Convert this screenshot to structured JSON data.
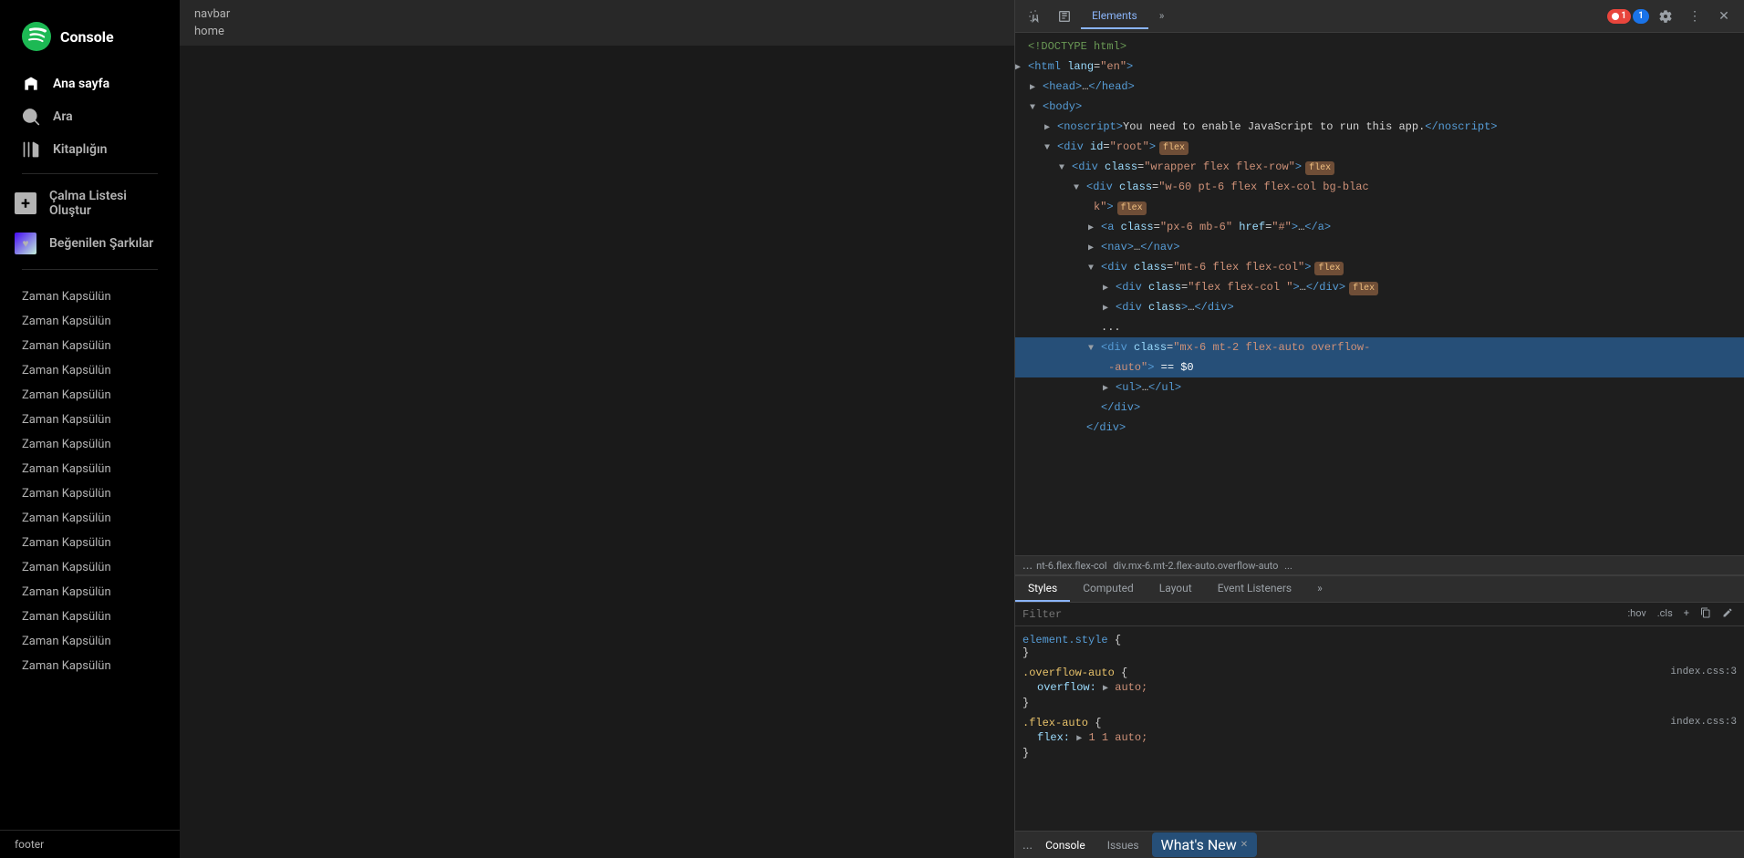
{
  "sidebar": {
    "logo_text": "Spotify",
    "nav_items": [
      {
        "id": "home",
        "label": "Ana sayfa",
        "icon": "home-icon",
        "active": true
      },
      {
        "id": "search",
        "label": "Ara",
        "icon": "search-icon",
        "active": false
      },
      {
        "id": "library",
        "label": "Kitaplığın",
        "icon": "library-icon",
        "active": false
      }
    ],
    "actions": [
      {
        "id": "create-playlist",
        "label": "Çalma Listesi Oluştur",
        "icon": "plus-icon"
      },
      {
        "id": "liked-songs",
        "label": "Beğenilen Şarkılar",
        "icon": "heart-icon"
      }
    ],
    "playlists": [
      "Zaman Kapsülün",
      "Zaman Kapsülün",
      "Zaman Kapsülün",
      "Zaman Kapsülün",
      "Zaman Kapsülün",
      "Zaman Kapsülün",
      "Zaman Kapsülün",
      "Zaman Kapsülün",
      "Zaman Kapsülün",
      "Zaman Kapsülün",
      "Zaman Kapsülün",
      "Zaman Kapsülün",
      "Zaman Kapsülün",
      "Zaman Kapsülün",
      "Zaman Kapsülün",
      "Zaman Kapsülün"
    ],
    "footer_label": "footer"
  },
  "main_content": {
    "header_labels": [
      "navbar",
      "home"
    ]
  },
  "devtools": {
    "toolbar": {
      "inspect_icon": "inspect-icon",
      "device_icon": "device-icon",
      "tabs": [
        "Elements",
        "»"
      ],
      "active_tab": "Elements",
      "error_badge": "1",
      "warning_badge": "1",
      "settings_icon": "settings-icon",
      "more_icon": "more-icon",
      "close_icon": "close-icon"
    },
    "dom": {
      "lines": [
        {
          "indent": 0,
          "triangle": "none",
          "content": "<!DOCTYPE html>",
          "type": "doctype"
        },
        {
          "indent": 0,
          "triangle": "closed",
          "content": "<html lang=\"en\">",
          "type": "tag"
        },
        {
          "indent": 1,
          "triangle": "closed",
          "content": "<head>…</head>",
          "type": "tag"
        },
        {
          "indent": 1,
          "triangle": "open",
          "content": "<body>",
          "type": "tag-open"
        },
        {
          "indent": 2,
          "triangle": "closed",
          "content": "<noscript>You need to enable JavaScript to run this app.</noscript>",
          "type": "tag"
        },
        {
          "indent": 2,
          "triangle": "open",
          "content": "<div id=\"root\">",
          "type": "tag-open",
          "badge": "flex"
        },
        {
          "indent": 3,
          "triangle": "open",
          "content": "<div class=\"wrapper flex flex-row\">",
          "type": "tag-open",
          "badge": "flex"
        },
        {
          "indent": 4,
          "triangle": "open",
          "content": "<div class=\"w-60 pt-6 flex flex-col bg-black\">",
          "type": "tag-open",
          "badge": "flex"
        },
        {
          "indent": 5,
          "triangle": "closed",
          "content": "<a class=\"px-6 mb-6\" href=\"#\">…</a>",
          "type": "tag"
        },
        {
          "indent": 5,
          "triangle": "closed",
          "content": "<nav>…</nav>",
          "type": "tag"
        },
        {
          "indent": 5,
          "triangle": "open",
          "content": "<div class=\"mt-6 flex flex-col\">",
          "type": "tag-open",
          "badge": "flex"
        },
        {
          "indent": 6,
          "triangle": "closed",
          "content": "<div class=\"flex flex-col \">…</div>",
          "type": "tag",
          "badge": "flex"
        },
        {
          "indent": 6,
          "triangle": "closed",
          "content": "<div class>…</div>",
          "type": "tag"
        },
        {
          "indent": 5,
          "triangle": "open",
          "content": "<div class=\"mx-6 mt-2 flex-auto overflow-auto\"> == $0",
          "type": "tag-open-selected",
          "badge": "none"
        },
        {
          "indent": 6,
          "triangle": "closed",
          "content": "<ul>…</ul>",
          "type": "tag"
        },
        {
          "indent": 5,
          "triangle": "none",
          "content": "</div>",
          "type": "tag-close"
        },
        {
          "indent": 4,
          "triangle": "none",
          "content": "</div>",
          "type": "tag-close"
        }
      ]
    },
    "breadcrumb": "... nt-6.flex.flex-col   div.mx-6.mt-2.flex-auto.overflow-auto   ...",
    "styles_panel": {
      "tabs": [
        "Styles",
        "Computed",
        "Layout",
        "Event Listeners",
        "»"
      ],
      "active_tab": "Styles",
      "filter_placeholder": "Filter",
      "filter_hints": [
        ":hov",
        ".cls",
        "+"
      ],
      "rules": [
        {
          "selector": "element.style",
          "source": "",
          "properties": []
        },
        {
          "selector": ".overflow-auto",
          "source": "index.css:3",
          "properties": [
            {
              "name": "overflow:",
              "value": "▶ auto;",
              "has_arrow": true
            }
          ]
        },
        {
          "selector": ".flex-auto",
          "source": "index.css:3",
          "properties": [
            {
              "name": "flex:",
              "value": "▶ 1 1 auto;",
              "has_arrow": true
            }
          ]
        }
      ]
    },
    "bottom_bar": {
      "tabs": [
        "Console",
        "Issues"
      ],
      "active_tab": "Console",
      "whats_new_label": "What's New",
      "ellipsis": "..."
    }
  }
}
